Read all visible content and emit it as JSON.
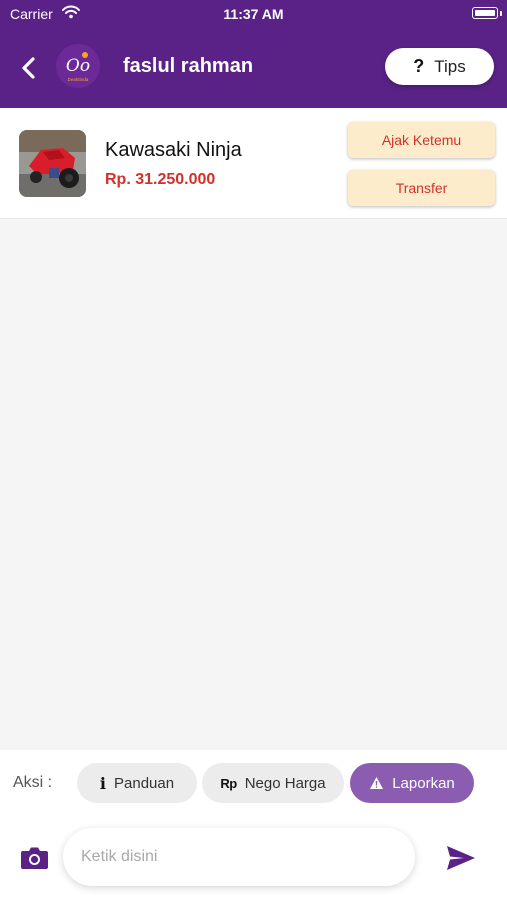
{
  "status_bar": {
    "carrier": "Carrier",
    "time": "11:37 AM"
  },
  "header": {
    "title": "faslul rahman",
    "tips_label": "Tips",
    "tips_icon": "?",
    "logo_text": "Oo",
    "logo_caption": "DealSinda",
    "background_color": "#5a2286"
  },
  "product": {
    "name": "Kawasaki Ninja",
    "price": "Rp. 31.250.000",
    "thumbnail_icon": "motorcycle-photo",
    "actions": {
      "meet_label": "Ajak Ketemu",
      "transfer_label": "Transfer"
    }
  },
  "actions_bar": {
    "label": "Aksi :",
    "chips": [
      {
        "label": "Panduan",
        "icon": "i"
      },
      {
        "label": "Nego Harga",
        "icon": "Rp"
      },
      {
        "label": "Laporkan",
        "icon": "warning-icon"
      }
    ]
  },
  "composer": {
    "placeholder": "Ketik disini"
  },
  "colors": {
    "brand_purple": "#5a2286",
    "accent_purple": "#8a5db1",
    "price_red": "#d4302b",
    "action_button_bg": "#fdeccb"
  }
}
